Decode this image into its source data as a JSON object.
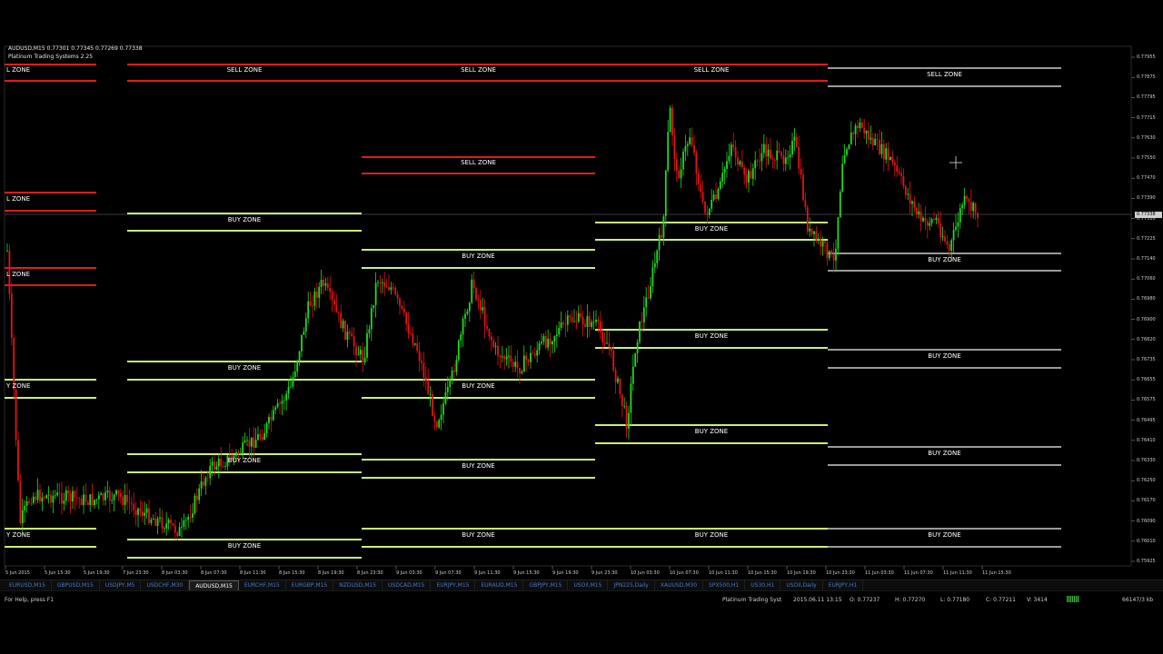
{
  "chart": {
    "symbol_line": "AUDUSD,M15  0.77301 0.77345 0.77269 0.77338",
    "indicator_name": "Platinum Trading Systems 2.25",
    "price_ticks": [
      "0.77955",
      "0.77875",
      "0.77795",
      "0.77715",
      "0.77630",
      "0.77550",
      "0.77470",
      "0.77390",
      "0.77310",
      "0.77225",
      "0.77140",
      "0.77060",
      "0.76980",
      "0.76900",
      "0.76820",
      "0.76735",
      "0.76655",
      "0.76575",
      "0.76495",
      "0.76410",
      "0.76330",
      "0.76250",
      "0.76170",
      "0.76090",
      "0.76010",
      "0.75925"
    ],
    "current_price": "0.77338",
    "time_ticks": [
      "5 Jun 2015",
      "5 Jun 15:30",
      "5 Jun 19:30",
      "7 Jun 23:30",
      "8 Jun 03:30",
      "8 Jun 07:30",
      "8 Jun 11:30",
      "8 Jun 15:30",
      "8 Jun 19:30",
      "8 Jun 23:30",
      "9 Jun 03:30",
      "9 Jun 07:30",
      "9 Jun 11:30",
      "9 Jun 15:30",
      "9 Jun 19:30",
      "9 Jun 23:30",
      "10 Jun 03:30",
      "10 Jun 07:30",
      "10 Jun 11:30",
      "10 Jun 15:30",
      "10 Jun 19:30",
      "10 Jun 23:30",
      "11 Jun 03:30",
      "11 Jun 07:30",
      "11 Jun 11:30",
      "11 Jun 15:30"
    ],
    "zone_labels": {
      "sell": "SELL ZONE",
      "buy": "BUY ZONE",
      "partial": "L ZONE",
      "partial_buy": "Y ZONE"
    },
    "colors": {
      "sell": "#e01b1b",
      "buy": "#c8f27a",
      "grey": "#9a9a9a",
      "bull": "#22d922",
      "bear": "#e31414",
      "grid": "#444444"
    }
  },
  "tabs": [
    {
      "label": "EURUSD,M15",
      "active": false
    },
    {
      "label": "GBPUSD,M15",
      "active": false
    },
    {
      "label": "USDJPY,M5",
      "active": false
    },
    {
      "label": "USDCHF,M30",
      "active": false
    },
    {
      "label": "AUDUSD,M15",
      "active": true
    },
    {
      "label": "EURCHF,M15",
      "active": false
    },
    {
      "label": "EURGBP,M15",
      "active": false
    },
    {
      "label": "NZDUSD,M15",
      "active": false
    },
    {
      "label": "USDCAD,M15",
      "active": false
    },
    {
      "label": "EURJPY,M15",
      "active": false
    },
    {
      "label": "EURAUD,M15",
      "active": false
    },
    {
      "label": "GBPJPY,M15",
      "active": false
    },
    {
      "label": "USOil,M15",
      "active": false
    },
    {
      "label": "JPN225,Daily",
      "active": false
    },
    {
      "label": "XAUUSD,M30",
      "active": false
    },
    {
      "label": "SPX500,H1",
      "active": false
    },
    {
      "label": "US30,H1",
      "active": false
    },
    {
      "label": "USOil,Daily",
      "active": false
    },
    {
      "label": "EURJPY,H1",
      "active": false
    }
  ],
  "status": {
    "help": "For Help, press F1",
    "profile": "Platinum Trading Syst",
    "datetime": "2015.06.11 13:15",
    "open": "O: 0.77237",
    "high": "H: 0.77270",
    "low": "L: 0.77180",
    "close": "C: 0.77211",
    "volume": "V: 3414",
    "traffic": "66147/3 kb"
  }
}
